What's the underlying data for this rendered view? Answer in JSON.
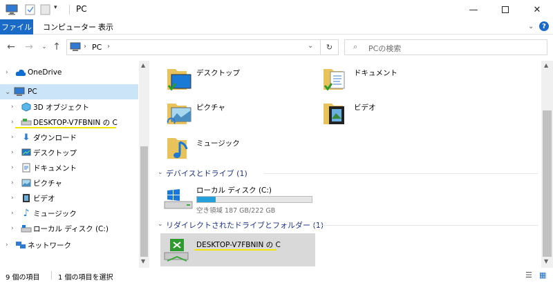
{
  "window": {
    "title": "PC"
  },
  "ribbon": {
    "tabs": [
      "ファイル",
      "コンピューター",
      "表示"
    ]
  },
  "address": {
    "crumbs": [
      "PC"
    ]
  },
  "search": {
    "placeholder": "PCの検索"
  },
  "nav_tree": [
    {
      "label": "OneDrive",
      "icon": "cloud-icon"
    },
    {
      "label": "PC",
      "icon": "computer-icon",
      "selected": true
    },
    {
      "label": "3D オブジェクト",
      "icon": "3d-objects-icon"
    },
    {
      "label": "DESKTOP-V7FBNIN の C",
      "icon": "network-drive-icon"
    },
    {
      "label": "ダウンロード",
      "icon": "download-icon"
    },
    {
      "label": "デスクトップ",
      "icon": "desktop-icon"
    },
    {
      "label": "ドキュメント",
      "icon": "document-icon"
    },
    {
      "label": "ピクチャ",
      "icon": "picture-icon"
    },
    {
      "label": "ビデオ",
      "icon": "video-icon"
    },
    {
      "label": "ミュージック",
      "icon": "music-icon"
    },
    {
      "label": "ローカル ディスク (C:)",
      "icon": "local-disk-icon"
    },
    {
      "label": "ネットワーク",
      "icon": "network-icon"
    }
  ],
  "folders": [
    "デスクトップ",
    "ドキュメント",
    "ピクチャ",
    "ビデオ",
    "ミュージック"
  ],
  "groups": {
    "devices": "デバイスとドライブ (1)",
    "redirected": "リダイレクトされたドライブとフォルダー (1)"
  },
  "drive": {
    "name": "ローカル ディスク (C:)",
    "free": "空き領域 187 GB/222 GB",
    "used_fraction": 0.16
  },
  "redirected_drive": {
    "name": "DESKTOP-V7FBNIN の C"
  },
  "status": {
    "count": "9 個の項目",
    "selected": "1 個の項目を選択"
  },
  "colors": {
    "accent": "#1a6ac8",
    "highlight": "#f2e600",
    "selection": "#cce4f7",
    "drive_bar": "#26a0da"
  }
}
